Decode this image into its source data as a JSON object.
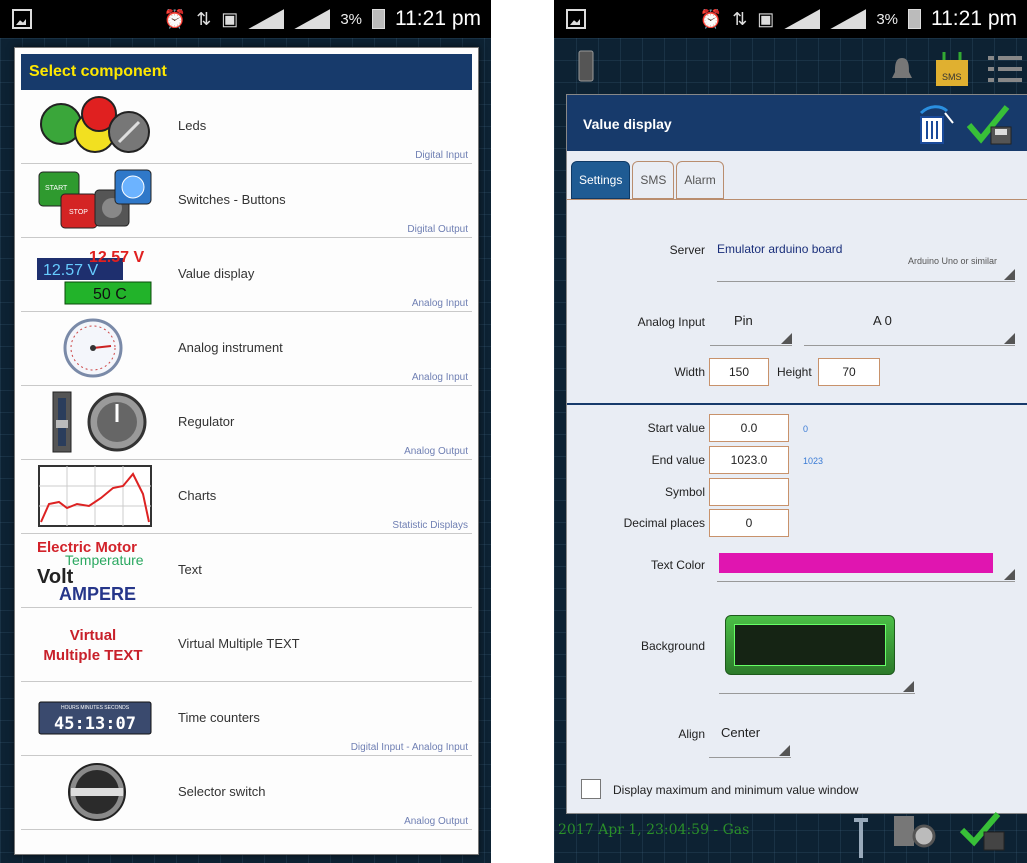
{
  "status": {
    "battery_pct": "3%",
    "time": "11:21 pm"
  },
  "left": {
    "dialog_title": "Select component",
    "components": [
      {
        "name": "Leds",
        "category": "Digital Input",
        "icon": "leds-icon"
      },
      {
        "name": "Switches - Buttons",
        "category": "Digital Output",
        "icon": "switches-buttons-icon"
      },
      {
        "name": "Value display",
        "category": "Analog Input",
        "icon": "value-display-icon",
        "preview": {
          "v1": "12.57 V",
          "v2": "12.57 V",
          "t": "50 C"
        }
      },
      {
        "name": "Analog instrument",
        "category": "Analog Input",
        "icon": "analog-instrument-icon"
      },
      {
        "name": "Regulator",
        "category": "Analog Output",
        "icon": "regulator-icon"
      },
      {
        "name": "Charts",
        "category": "Statistic Displays",
        "icon": "charts-icon"
      },
      {
        "name": "Text",
        "category": "",
        "icon": "text-icon",
        "preview": {
          "a": "Electric Motor",
          "b": "Temperature",
          "c": "Volt",
          "d": "AMPERE"
        }
      },
      {
        "name": "Virtual Multiple TEXT",
        "category": "",
        "icon": "virtual-multiple-text-icon",
        "preview": {
          "a": "Virtual",
          "b": "Multiple TEXT"
        }
      },
      {
        "name": "Time counters",
        "category": "Digital Input - Analog Input",
        "icon": "time-counters-icon",
        "preview": {
          "digits": "45:13:07",
          "labels": "HOURS MINUTES SECONDS"
        }
      },
      {
        "name": "Selector switch",
        "category": "Analog Output",
        "icon": "selector-switch-icon"
      }
    ]
  },
  "right": {
    "dialog_title": "Value display",
    "tabs": [
      "Settings",
      "SMS",
      "Alarm"
    ],
    "active_tab": "Settings",
    "server": {
      "label": "Server",
      "value": "Emulator arduino board",
      "sub": "Arduino Uno or similar"
    },
    "analog_input": {
      "label": "Analog Input",
      "pin_label": "Pin",
      "pin_value": "A 0"
    },
    "size": {
      "width_label": "Width",
      "width": "150",
      "height_label": "Height",
      "height": "70"
    },
    "start": {
      "label": "Start value",
      "value": "0.0",
      "hint": "0"
    },
    "end": {
      "label": "End value",
      "value": "1023.0",
      "hint": "1023"
    },
    "symbol": {
      "label": "Symbol",
      "value": ""
    },
    "decimals": {
      "label": "Decimal places",
      "value": "0"
    },
    "text_color": {
      "label": "Text Color",
      "color": "#e015b0"
    },
    "background": {
      "label": "Background"
    },
    "align": {
      "label": "Align",
      "value": "Center"
    },
    "minmax": {
      "label": "Display maximum and minimum value window",
      "checked": false
    },
    "footer_status": "2017 Apr 1, 23:04:59 - Gas"
  }
}
